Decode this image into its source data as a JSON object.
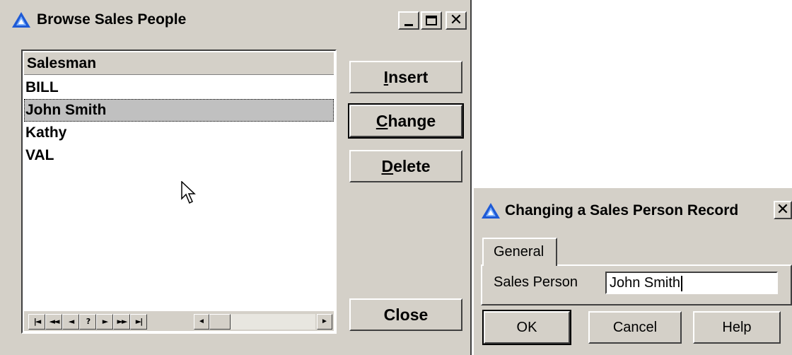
{
  "browse_window": {
    "title": "Browse Sales People",
    "column_header": "Salesman",
    "rows": [
      "BILL",
      "John Smith",
      "Kathy",
      "VAL"
    ],
    "selected_row": "John Smith",
    "nav_buttons": [
      "|◄",
      "◄◄",
      "◄",
      "?",
      "►",
      "►►",
      "►|"
    ],
    "buttons": {
      "insert": "Insert",
      "change": "Change",
      "delete": "Delete",
      "close": "Close"
    }
  },
  "change_dialog": {
    "title": "Changing a Sales Person Record",
    "tab_label": "General",
    "field_label": "Sales Person",
    "field_value": "John Smith",
    "buttons": {
      "ok": "OK",
      "cancel": "Cancel",
      "help": "Help"
    }
  },
  "colors": {
    "window_bg": "#d4d0c8",
    "selection_bg": "#c0c0c0",
    "icon_blue": "#1e5ad6"
  }
}
